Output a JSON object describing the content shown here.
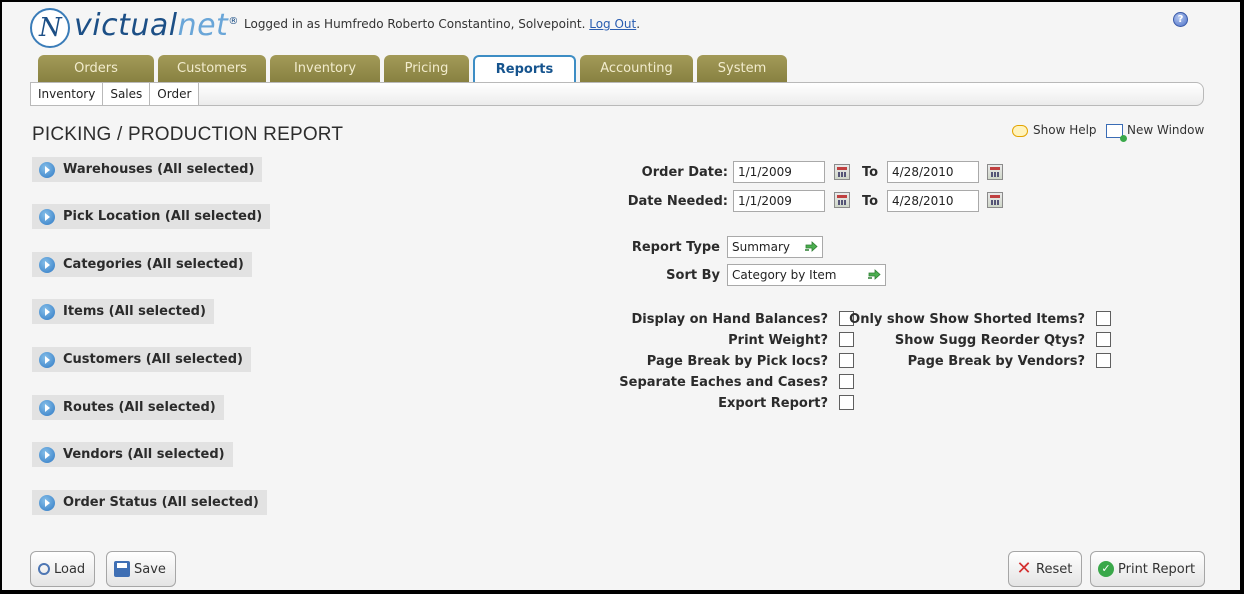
{
  "brand": {
    "logo_mark": "N",
    "logo_main": "victual",
    "logo_net": "net",
    "logo_reg": "®"
  },
  "header": {
    "login_text": "Logged in as Humfredo Roberto Constantino, Solvepoint.",
    "logout_label": "Log Out",
    "logout_suffix": ".",
    "help_icon": "question-icon"
  },
  "tabs": [
    {
      "label": "Orders",
      "active": false
    },
    {
      "label": "Customers",
      "active": false
    },
    {
      "label": "Inventory",
      "active": false
    },
    {
      "label": "Pricing",
      "active": false
    },
    {
      "label": "Reports",
      "active": true
    },
    {
      "label": "Accounting",
      "active": false
    },
    {
      "label": "System",
      "active": false
    }
  ],
  "subnav": [
    "Inventory",
    "Sales",
    "Order"
  ],
  "page": {
    "title": "PICKING / PRODUCTION REPORT",
    "show_help": "Show Help",
    "new_window": "New Window"
  },
  "filters": [
    "Warehouses (All selected)",
    "Pick Location (All selected)",
    "Categories (All selected)",
    "Items (All selected)",
    "Customers (All selected)",
    "Routes (All selected)",
    "Vendors (All selected)",
    "Order Status (All selected)"
  ],
  "form": {
    "order_date_label": "Order Date:",
    "order_date_from": "1/1/2009",
    "order_date_to_label": "To",
    "order_date_to": "4/28/2010",
    "date_needed_label": "Date Needed:",
    "date_needed_from": "1/1/2009",
    "date_needed_to_label": "To",
    "date_needed_to": "4/28/2010",
    "report_type_label": "Report Type",
    "report_type_value": "Summary",
    "sort_by_label": "Sort By",
    "sort_by_value": "Category by Item",
    "checkboxes_left": [
      {
        "label": "Display on Hand Balances?",
        "checked": false
      },
      {
        "label": "Print Weight?",
        "checked": false
      },
      {
        "label": "Page Break by Pick locs?",
        "checked": false
      },
      {
        "label": "Separate Eaches and Cases?",
        "checked": false
      },
      {
        "label": "Export Report?",
        "checked": false
      }
    ],
    "checkboxes_right": [
      {
        "label": "Only show Show Shorted Items?",
        "checked": false
      },
      {
        "label": "Show Sugg Reorder Qtys?",
        "checked": false
      },
      {
        "label": "Page Break by Vendors?",
        "checked": false
      }
    ]
  },
  "buttons": {
    "load": "Load",
    "save": "Save",
    "reset": "Reset",
    "print": "Print Report"
  },
  "colors": {
    "tab_bg": "#968e4c",
    "tab_active_border": "#3d8dc4",
    "brand_blue": "#1c4f86"
  }
}
